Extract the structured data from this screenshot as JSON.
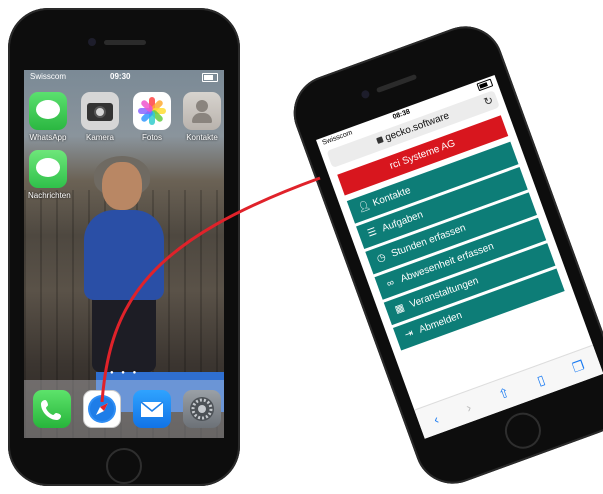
{
  "left_phone": {
    "status": {
      "carrier": "Swisscom",
      "time": "09:30"
    },
    "apps": [
      {
        "label": "WhatsApp",
        "icon": "whatsapp-icon"
      },
      {
        "label": "Kamera",
        "icon": "camera-icon"
      },
      {
        "label": "Fotos",
        "icon": "photos-icon"
      },
      {
        "label": "Kontakte",
        "icon": "contacts-icon"
      },
      {
        "label": "Nachrichten",
        "icon": "messages-icon"
      }
    ],
    "dock": [
      {
        "icon": "phone-icon"
      },
      {
        "icon": "safari-icon"
      },
      {
        "icon": "mail-icon"
      },
      {
        "icon": "settings-icon"
      }
    ]
  },
  "right_phone": {
    "status": {
      "carrier": "Swisscom",
      "time": "08:38"
    },
    "url": "gecko.software",
    "company": "rci Systeme AG",
    "menu": [
      {
        "label": "Kontakte",
        "icon": "person-icon"
      },
      {
        "label": "Aufgaben",
        "icon": "tasks-icon"
      },
      {
        "label": "Stunden erfassen",
        "icon": "clock-icon"
      },
      {
        "label": "Abwesenheit erfassen",
        "icon": "glasses-icon"
      },
      {
        "label": "Veranstaltungen",
        "icon": "calendar-icon"
      },
      {
        "label": "Abmelden",
        "icon": "logout-icon"
      }
    ]
  },
  "colors": {
    "accent": "#0d7d77",
    "header_red": "#d8161e",
    "connector": "#e0222a"
  }
}
